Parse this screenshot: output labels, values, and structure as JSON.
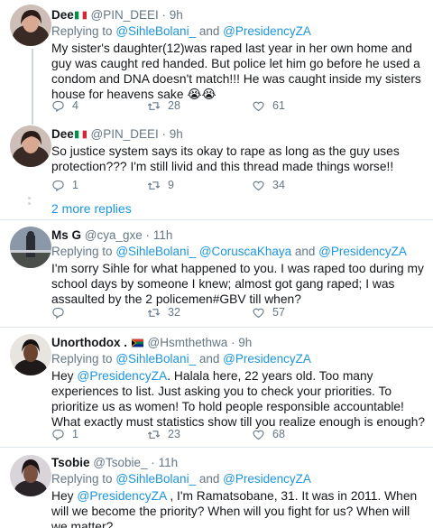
{
  "tweets": [
    {
      "name": "Dee",
      "handle": "@PIN_DEEI",
      "time": "9h",
      "flag": "italy-flag",
      "replying_prefix": "Replying to",
      "replying_mentions": [
        "@SihleBolani_",
        "@PresidencyZA"
      ],
      "replying_joiner": "and",
      "text": "My sister's daughter(12)was raped last year in her own home and guy was caught red handed. But police let him go before he used a condom and DNA doesn't match!!! He was caught inside my sisters house for heavens sake 😭😭",
      "replies": "4",
      "retweets": "28",
      "likes": "61"
    },
    {
      "name": "Dee",
      "handle": "@PIN_DEEI",
      "time": "9h",
      "flag": "italy-flag",
      "text": "So justice system says its okay to rape as long as the guy uses protection??? I'm still livid and this thread made things worse!!",
      "replies": "1",
      "retweets": "9",
      "likes": "34"
    },
    {
      "name": "Ms G",
      "handle": "@cya_gxe",
      "time": "11h",
      "replying_prefix": "Replying to",
      "replying_mentions": [
        "@SihleBolani_",
        "@CoruscaKhaya",
        "@PresidencyZA"
      ],
      "replying_joiner": "and",
      "text": "I'm sorry Sihle for what happened to you. I was raped too during my school days by someone I knew; almost got gang raped; I was assaulted by the 2 policemen#GBV till when?",
      "replies": "",
      "retweets": "32",
      "likes": "57"
    },
    {
      "name": "Unorthodox .",
      "handle": "@Hsmthethwa",
      "time": "9h",
      "flag": "south-africa-flag",
      "replying_prefix": "Replying to",
      "replying_mentions": [
        "@SihleBolani_",
        "@PresidencyZA"
      ],
      "replying_joiner": "and",
      "text_mention": "@PresidencyZA",
      "text_before": "Hey ",
      "text_after": ". Halala here, 22 years old. Too many experiences to list. Just asking you to check your priorities. To prioritize us as women! To hold people responsible accountable! What exactly must statistics show till you realize enough is enough?",
      "replies": "1",
      "retweets": "23",
      "likes": "68"
    },
    {
      "name": "Tsobie",
      "handle": "@Tsobie_",
      "time": "11h",
      "replying_prefix": "Replying to",
      "replying_mentions": [
        "@SihleBolani_",
        "@PresidencyZA"
      ],
      "replying_joiner": "and",
      "text_mention": "@PresidencyZA",
      "text_before": "Hey ",
      "text_after": " , I'm Ramatsobane, 31. It was in 2011. When will we become the priority? When will you fight for us? When will we matter?"
    }
  ],
  "more_replies_label": "2 more replies",
  "time_separator": "·",
  "colors": {
    "link": "#1b95e0",
    "secondary": "#657786",
    "divider": "#e1e8ed",
    "thread_line": "#ccd6dd"
  },
  "icons": [
    "reply-icon",
    "retweet-icon",
    "like-icon"
  ]
}
